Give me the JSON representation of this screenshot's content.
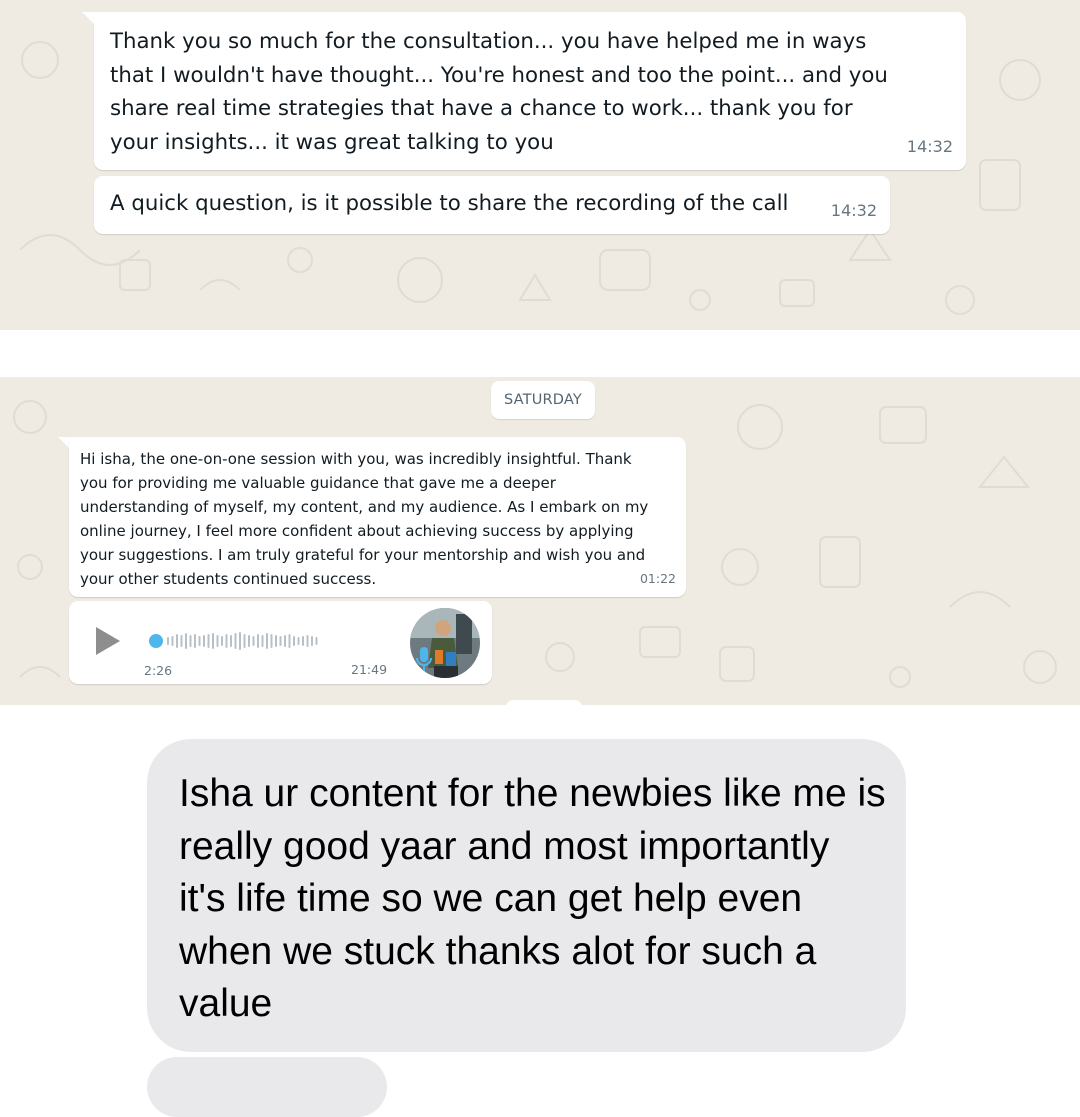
{
  "whatsapp_chat_1": {
    "messages": [
      {
        "text": "Thank you so much for the consultation... you have helped me in ways that I wouldn't have thought... You're honest and too the point... and you share real time strategies that have a chance to work... thank you for your insights... it was great talking to you",
        "time": "14:32"
      },
      {
        "text": "A quick question, is it possible to share the recording of the call",
        "time": "14:32"
      }
    ]
  },
  "whatsapp_chat_2": {
    "day_divider": "SATURDAY",
    "message": {
      "text": "Hi isha, the one-on-one session with you, was incredibly insightful. Thank you for providing me valuable guidance that gave me a deeper understanding of myself, my content, and my audience. As I embark on my online journey, I feel more confident about achieving success by applying your suggestions. I am truly grateful for your mentorship and wish you and your other students continued success.",
      "time": "01:22"
    },
    "voice_note": {
      "duration": "2:26",
      "time": "21:49",
      "progress": 0,
      "icons": [
        "play-icon",
        "mic-icon"
      ]
    }
  },
  "imessage": {
    "text": "Isha ur content for the newbies like me is really good yaar and most importantly it's life time so we can get help even when we stuck thanks alot for such a value"
  },
  "colors": {
    "chat_background": "#efeae2",
    "bubble": "#ffffff",
    "timestamp": "#667781",
    "voice_accent": "#4fb6ec",
    "imessage_bubble": "#e9e9eb"
  }
}
